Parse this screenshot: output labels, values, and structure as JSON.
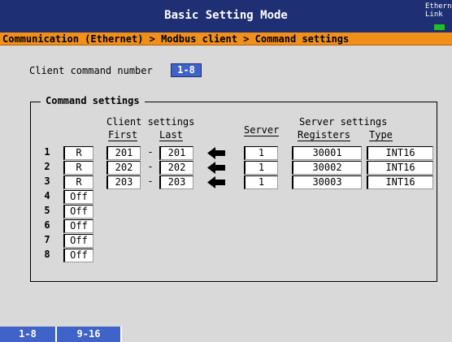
{
  "header": {
    "title": "Basic Setting Mode",
    "status_label": "Ethernet\nLink",
    "status_color": "#20c020"
  },
  "breadcrumb": "Communication (Ethernet) > Modbus client > Command settings",
  "client_command": {
    "label": "Client command number",
    "value": "1-8"
  },
  "command_settings": {
    "title": "Command settings",
    "client_header": "Client settings",
    "server_header": "Server settings",
    "columns": {
      "first": "First",
      "last": "Last",
      "server": "Server",
      "registers": "Registers",
      "type": "Type"
    },
    "rows": [
      {
        "num": "1",
        "mode": "R",
        "first": "201",
        "last": "201",
        "server": "1",
        "register": "30001",
        "type": "INT16"
      },
      {
        "num": "2",
        "mode": "R",
        "first": "202",
        "last": "202",
        "server": "1",
        "register": "30002",
        "type": "INT16"
      },
      {
        "num": "3",
        "mode": "R",
        "first": "203",
        "last": "203",
        "server": "1",
        "register": "30003",
        "type": "INT16"
      },
      {
        "num": "4",
        "mode": "Off"
      },
      {
        "num": "5",
        "mode": "Off"
      },
      {
        "num": "6",
        "mode": "Off"
      },
      {
        "num": "7",
        "mode": "Off"
      },
      {
        "num": "8",
        "mode": "Off"
      }
    ]
  },
  "page_tabs": [
    "1-8",
    "9-16"
  ]
}
